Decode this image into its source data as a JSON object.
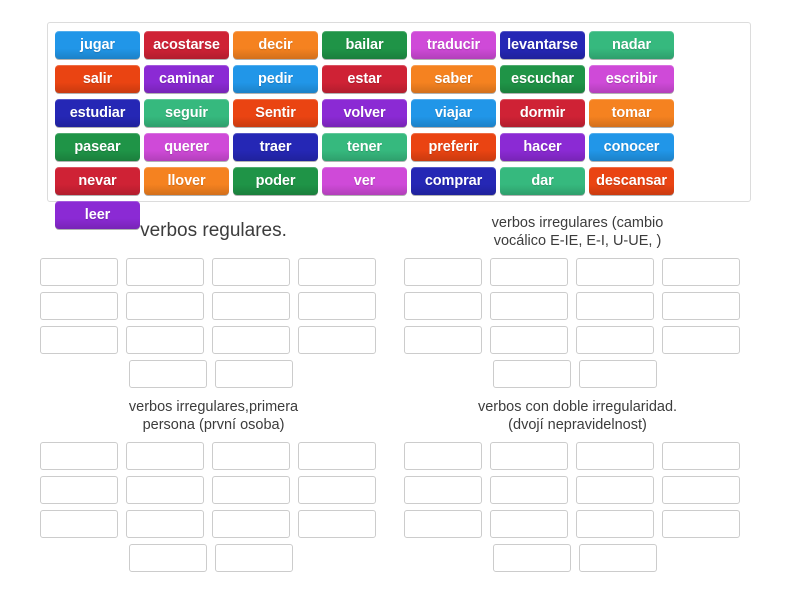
{
  "activity": {
    "type": "group-sort",
    "columns": 4,
    "slots_per_category": 14,
    "slot_rows": [
      4,
      4,
      4,
      2
    ]
  },
  "word_bank": {
    "name": "verb-word-bank",
    "tiles": [
      {
        "label": "jugar",
        "color": "#2196e8"
      },
      {
        "label": "acostarse",
        "color": "#cf2235"
      },
      {
        "label": "decir",
        "color": "#f58220"
      },
      {
        "label": "bailar",
        "color": "#1f9447"
      },
      {
        "label": "traducir",
        "color": "#cf4ad8"
      },
      {
        "label": "levantarse",
        "color": "#2527b5"
      },
      {
        "label": "nadar",
        "color": "#36b97e"
      },
      {
        "label": "salir",
        "color": "#ea4412"
      },
      {
        "label": "caminar",
        "color": "#8b2ad4"
      },
      {
        "label": "pedir",
        "color": "#2196e8"
      },
      {
        "label": "estar",
        "color": "#cf2235"
      },
      {
        "label": "saber",
        "color": "#f58220"
      },
      {
        "label": "escuchar",
        "color": "#1f9447"
      },
      {
        "label": "escribir",
        "color": "#cf4ad8"
      },
      {
        "label": "estudiar",
        "color": "#2527b5"
      },
      {
        "label": "seguir",
        "color": "#36b97e"
      },
      {
        "label": "Sentir",
        "color": "#ea4412"
      },
      {
        "label": "volver",
        "color": "#8b2ad4"
      },
      {
        "label": "viajar",
        "color": "#2196e8"
      },
      {
        "label": "dormir",
        "color": "#cf2235"
      },
      {
        "label": "tomar",
        "color": "#f58220"
      },
      {
        "label": "pasear",
        "color": "#1f9447"
      },
      {
        "label": "querer",
        "color": "#cf4ad8"
      },
      {
        "label": "traer",
        "color": "#2527b5"
      },
      {
        "label": "tener",
        "color": "#36b97e"
      },
      {
        "label": "preferir",
        "color": "#ea4412"
      },
      {
        "label": "hacer",
        "color": "#8b2ad4"
      },
      {
        "label": "conocer",
        "color": "#2196e8"
      },
      {
        "label": "nevar",
        "color": "#cf2235"
      },
      {
        "label": "llover",
        "color": "#f58220"
      },
      {
        "label": "poder",
        "color": "#1f9447"
      },
      {
        "label": "ver",
        "color": "#cf4ad8"
      },
      {
        "label": "comprar",
        "color": "#2527b5"
      },
      {
        "label": "dar",
        "color": "#36b97e"
      },
      {
        "label": "descansar",
        "color": "#ea4412"
      },
      {
        "label": "leer",
        "color": "#8b2ad4"
      }
    ]
  },
  "categories": [
    {
      "name": "category-verbos-regulares",
      "title": "verbos regulares.",
      "title_lines": [
        "verbos regulares."
      ]
    },
    {
      "name": "category-verbos-irregulares-cambio-vocalico",
      "title": "verbos irregulares (cambio vocálico E-IE, E-I, U-UE, )",
      "title_lines": [
        "verbos irregulares (cambio",
        "vocálico E-IE, E-I, U-UE, )"
      ]
    },
    {
      "name": "category-verbos-irregulares-primera-persona",
      "title": "verbos irregulares,primera persona (první osoba)",
      "title_lines": [
        "verbos irregulares,primera",
        "persona (první osoba)"
      ]
    },
    {
      "name": "category-verbos-doble-irregularidad",
      "title": "verbos con doble irregularidad. (dvojí nepravidelnost)",
      "title_lines": [
        "verbos con doble irregularidad.",
        "(dvojí nepravidelnost)"
      ]
    }
  ]
}
